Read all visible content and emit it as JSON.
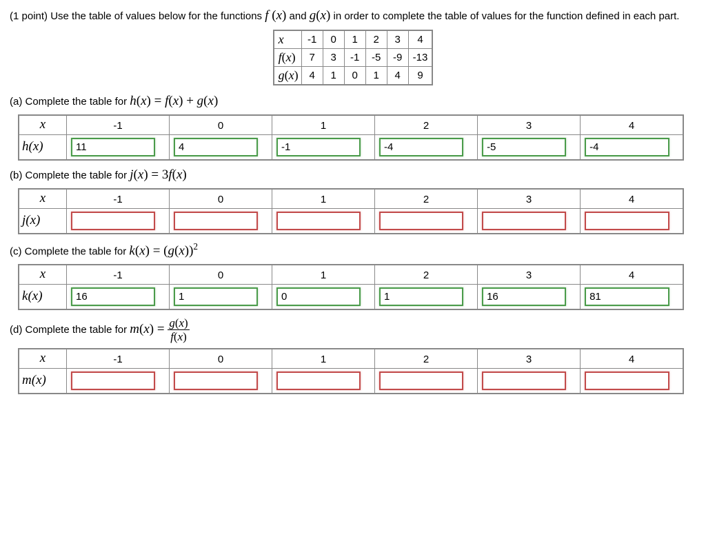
{
  "intro": {
    "points_prefix": "(1 point) ",
    "text_before_f": "Use the table of values below for the functions ",
    "f": "f (x)",
    "and": " and ",
    "g": "g(x)",
    "text_after": " in order to complete the table of values for the function defined in each part."
  },
  "given": {
    "x_label": "x",
    "f_label": "f(x)",
    "g_label": "g(x)",
    "x": [
      "-1",
      "0",
      "1",
      "2",
      "3",
      "4"
    ],
    "f": [
      "7",
      "3",
      "-1",
      "-5",
      "-9",
      "-13"
    ],
    "g": [
      "4",
      "1",
      "0",
      "1",
      "4",
      "9"
    ]
  },
  "xheader": [
    "-1",
    "0",
    "1",
    "2",
    "3",
    "4"
  ],
  "parts": {
    "a": {
      "label_prefix": "(a) Complete the table for ",
      "func_html": "h(x) = f(x) + g(x)",
      "row_label": "h(x)",
      "values": [
        "11",
        "4",
        "-1",
        "-4",
        "-5",
        "-4"
      ],
      "status": [
        "correct",
        "correct",
        "correct",
        "correct",
        "correct",
        "correct"
      ]
    },
    "b": {
      "label_prefix": "(b) Complete the table for ",
      "func_html": "j(x) = 3f(x)",
      "row_label": "j(x)",
      "values": [
        "",
        "",
        "",
        "",
        "",
        ""
      ],
      "status": [
        "wrong",
        "wrong",
        "wrong",
        "wrong",
        "wrong",
        "wrong"
      ]
    },
    "c": {
      "label_prefix": "(c) Complete the table for ",
      "func_html": "k(x) = (g(x))²",
      "row_label": "k(x)",
      "values": [
        "16",
        "1",
        "0",
        "1",
        "16",
        "81"
      ],
      "status": [
        "correct",
        "correct",
        "correct",
        "correct",
        "correct",
        "correct"
      ]
    },
    "d": {
      "label_prefix": "(d) Complete the table for ",
      "func_html": "m(x) = g(x) / f(x)",
      "row_label": "m(x)",
      "values": [
        "",
        "",
        "",
        "",
        "",
        ""
      ],
      "status": [
        "wrong",
        "wrong",
        "wrong",
        "wrong",
        "wrong",
        "wrong"
      ]
    }
  },
  "x_var": "x"
}
